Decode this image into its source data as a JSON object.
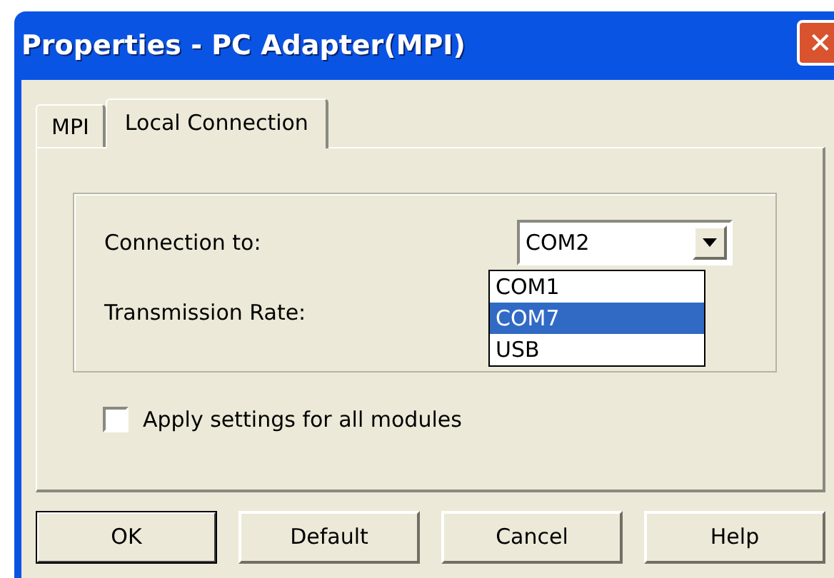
{
  "window": {
    "title": "Properties - PC Adapter(MPI)",
    "close": "✕"
  },
  "tabs": [
    {
      "label": "MPI",
      "selected": false
    },
    {
      "label": "Local Connection",
      "selected": true
    }
  ],
  "connection_to": {
    "label": "Connection to:",
    "value": "COM2",
    "options": [
      {
        "label": "COM1",
        "selected": false
      },
      {
        "label": "COM7",
        "selected": true
      },
      {
        "label": "USB",
        "selected": false
      }
    ]
  },
  "transmission_rate": {
    "label": "Transmission Rate:"
  },
  "apply_all": {
    "label": "Apply settings for all modules",
    "checked": false
  },
  "buttons": [
    {
      "label": "OK",
      "default": true
    },
    {
      "label": "Default",
      "default": false
    },
    {
      "label": "Cancel",
      "default": false
    },
    {
      "label": "Help",
      "default": false
    }
  ]
}
